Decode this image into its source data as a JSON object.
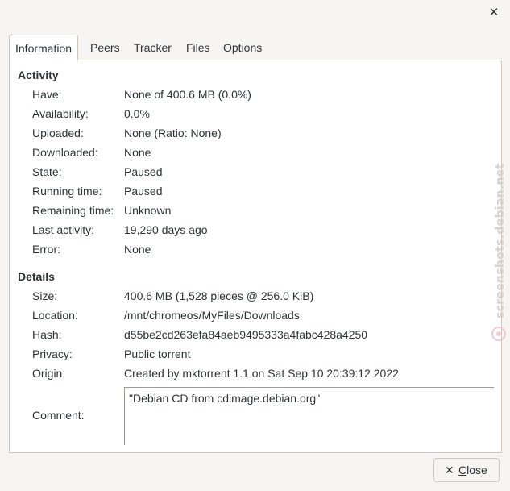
{
  "window": {
    "close_glyph": "✕"
  },
  "tabs": [
    {
      "label": "Information",
      "active": true
    },
    {
      "label": "Peers"
    },
    {
      "label": "Tracker"
    },
    {
      "label": "Files"
    },
    {
      "label": "Options"
    }
  ],
  "activity": {
    "heading": "Activity",
    "rows": [
      {
        "label": "Have:",
        "value": "None of 400.6 MB (0.0%)"
      },
      {
        "label": "Availability:",
        "value": "0.0%"
      },
      {
        "label": "Uploaded:",
        "value": "None (Ratio: None)"
      },
      {
        "label": "Downloaded:",
        "value": "None"
      },
      {
        "label": "State:",
        "value": "Paused"
      },
      {
        "label": "Running time:",
        "value": "Paused"
      },
      {
        "label": "Remaining time:",
        "value": "Unknown"
      },
      {
        "label": "Last activity:",
        "value": "19,290 days ago"
      },
      {
        "label": "Error:",
        "value": "None"
      }
    ]
  },
  "details": {
    "heading": "Details",
    "rows": [
      {
        "label": "Size:",
        "value": "400.6 MB (1,528 pieces @ 256.0 KiB)"
      },
      {
        "label": "Location:",
        "value": "/mnt/chromeos/MyFiles/Downloads"
      },
      {
        "label": "Hash:",
        "value": "d55be2cd263efa84aeb9495333a4fabc428a4250"
      },
      {
        "label": "Privacy:",
        "value": "Public torrent"
      },
      {
        "label": "Origin:",
        "value": "Created by mktorrent 1.1 on Sat Sep 10 20:39:12 2022"
      }
    ],
    "comment_label": "Comment:",
    "comment_value": "\"Debian CD from cdimage.debian.org\""
  },
  "watermark": {
    "text": "screenshots.debian.net"
  },
  "footer": {
    "close_icon": "✕",
    "close_label": "Close"
  }
}
